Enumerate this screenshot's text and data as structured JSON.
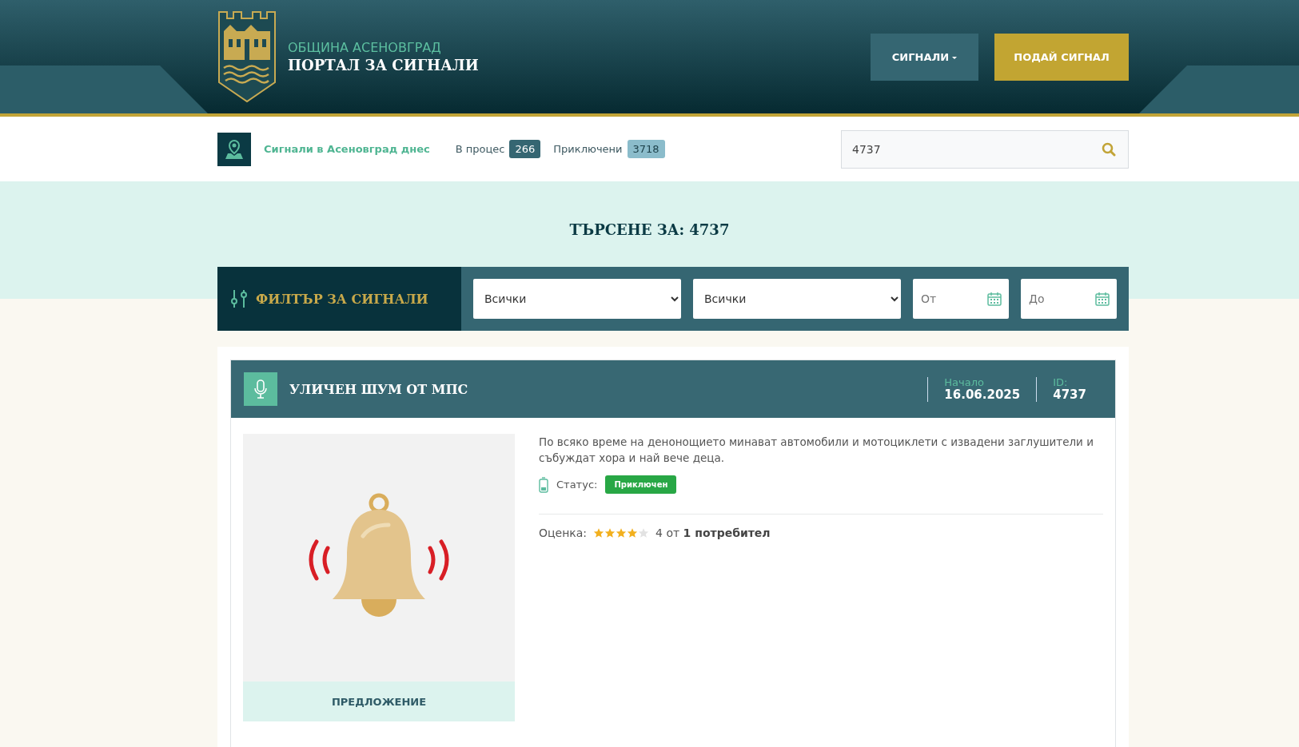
{
  "header": {
    "municipality": "ОБЩИНА АСЕНОВГРАД",
    "portal_title": "ПОРТАЛ ЗА СИГНАЛИ",
    "nav_buttons": [
      {
        "label": "СИГНАЛИ",
        "kind": "dropdown"
      },
      {
        "label": "ПОДАЙ СИГНАЛ",
        "kind": "primary"
      }
    ]
  },
  "stats_bar": {
    "title": "Сигнали в Асеновград днес",
    "counters": [
      {
        "label": "В процес",
        "count": "266",
        "kind": "progress"
      },
      {
        "label": "Приключени",
        "count": "3718",
        "kind": "done"
      }
    ],
    "search": {
      "value": "4737"
    }
  },
  "search_heading": "ТЪРСЕНЕ ЗА: 4737",
  "filter": {
    "title": "ФИЛТЪР ЗА СИГНАЛИ",
    "selects": [
      {
        "value": "Всички"
      },
      {
        "value": "Всички"
      }
    ],
    "date_fields": [
      {
        "placeholder": "От"
      },
      {
        "placeholder": "До"
      }
    ]
  },
  "signals": [
    {
      "title": "УЛИЧЕН ШУМ ОТ МПС",
      "start_label": "Начало",
      "start_date": "16.06.2025",
      "id_label": "ID:",
      "id": "4737",
      "description": "По всяко време на денонощието минават автомобили и мотоциклети с извадени заглушители и събуждат хора и най вече деца.",
      "status_label": "Статус:",
      "status": "Приключен",
      "color": "#28a745",
      "rating_label": "Оценка:",
      "stars": 4,
      "rating_text": "4 от **1 потребител**",
      "category": "ПРЕДЛОЖЕНИЕ"
    }
  ]
}
